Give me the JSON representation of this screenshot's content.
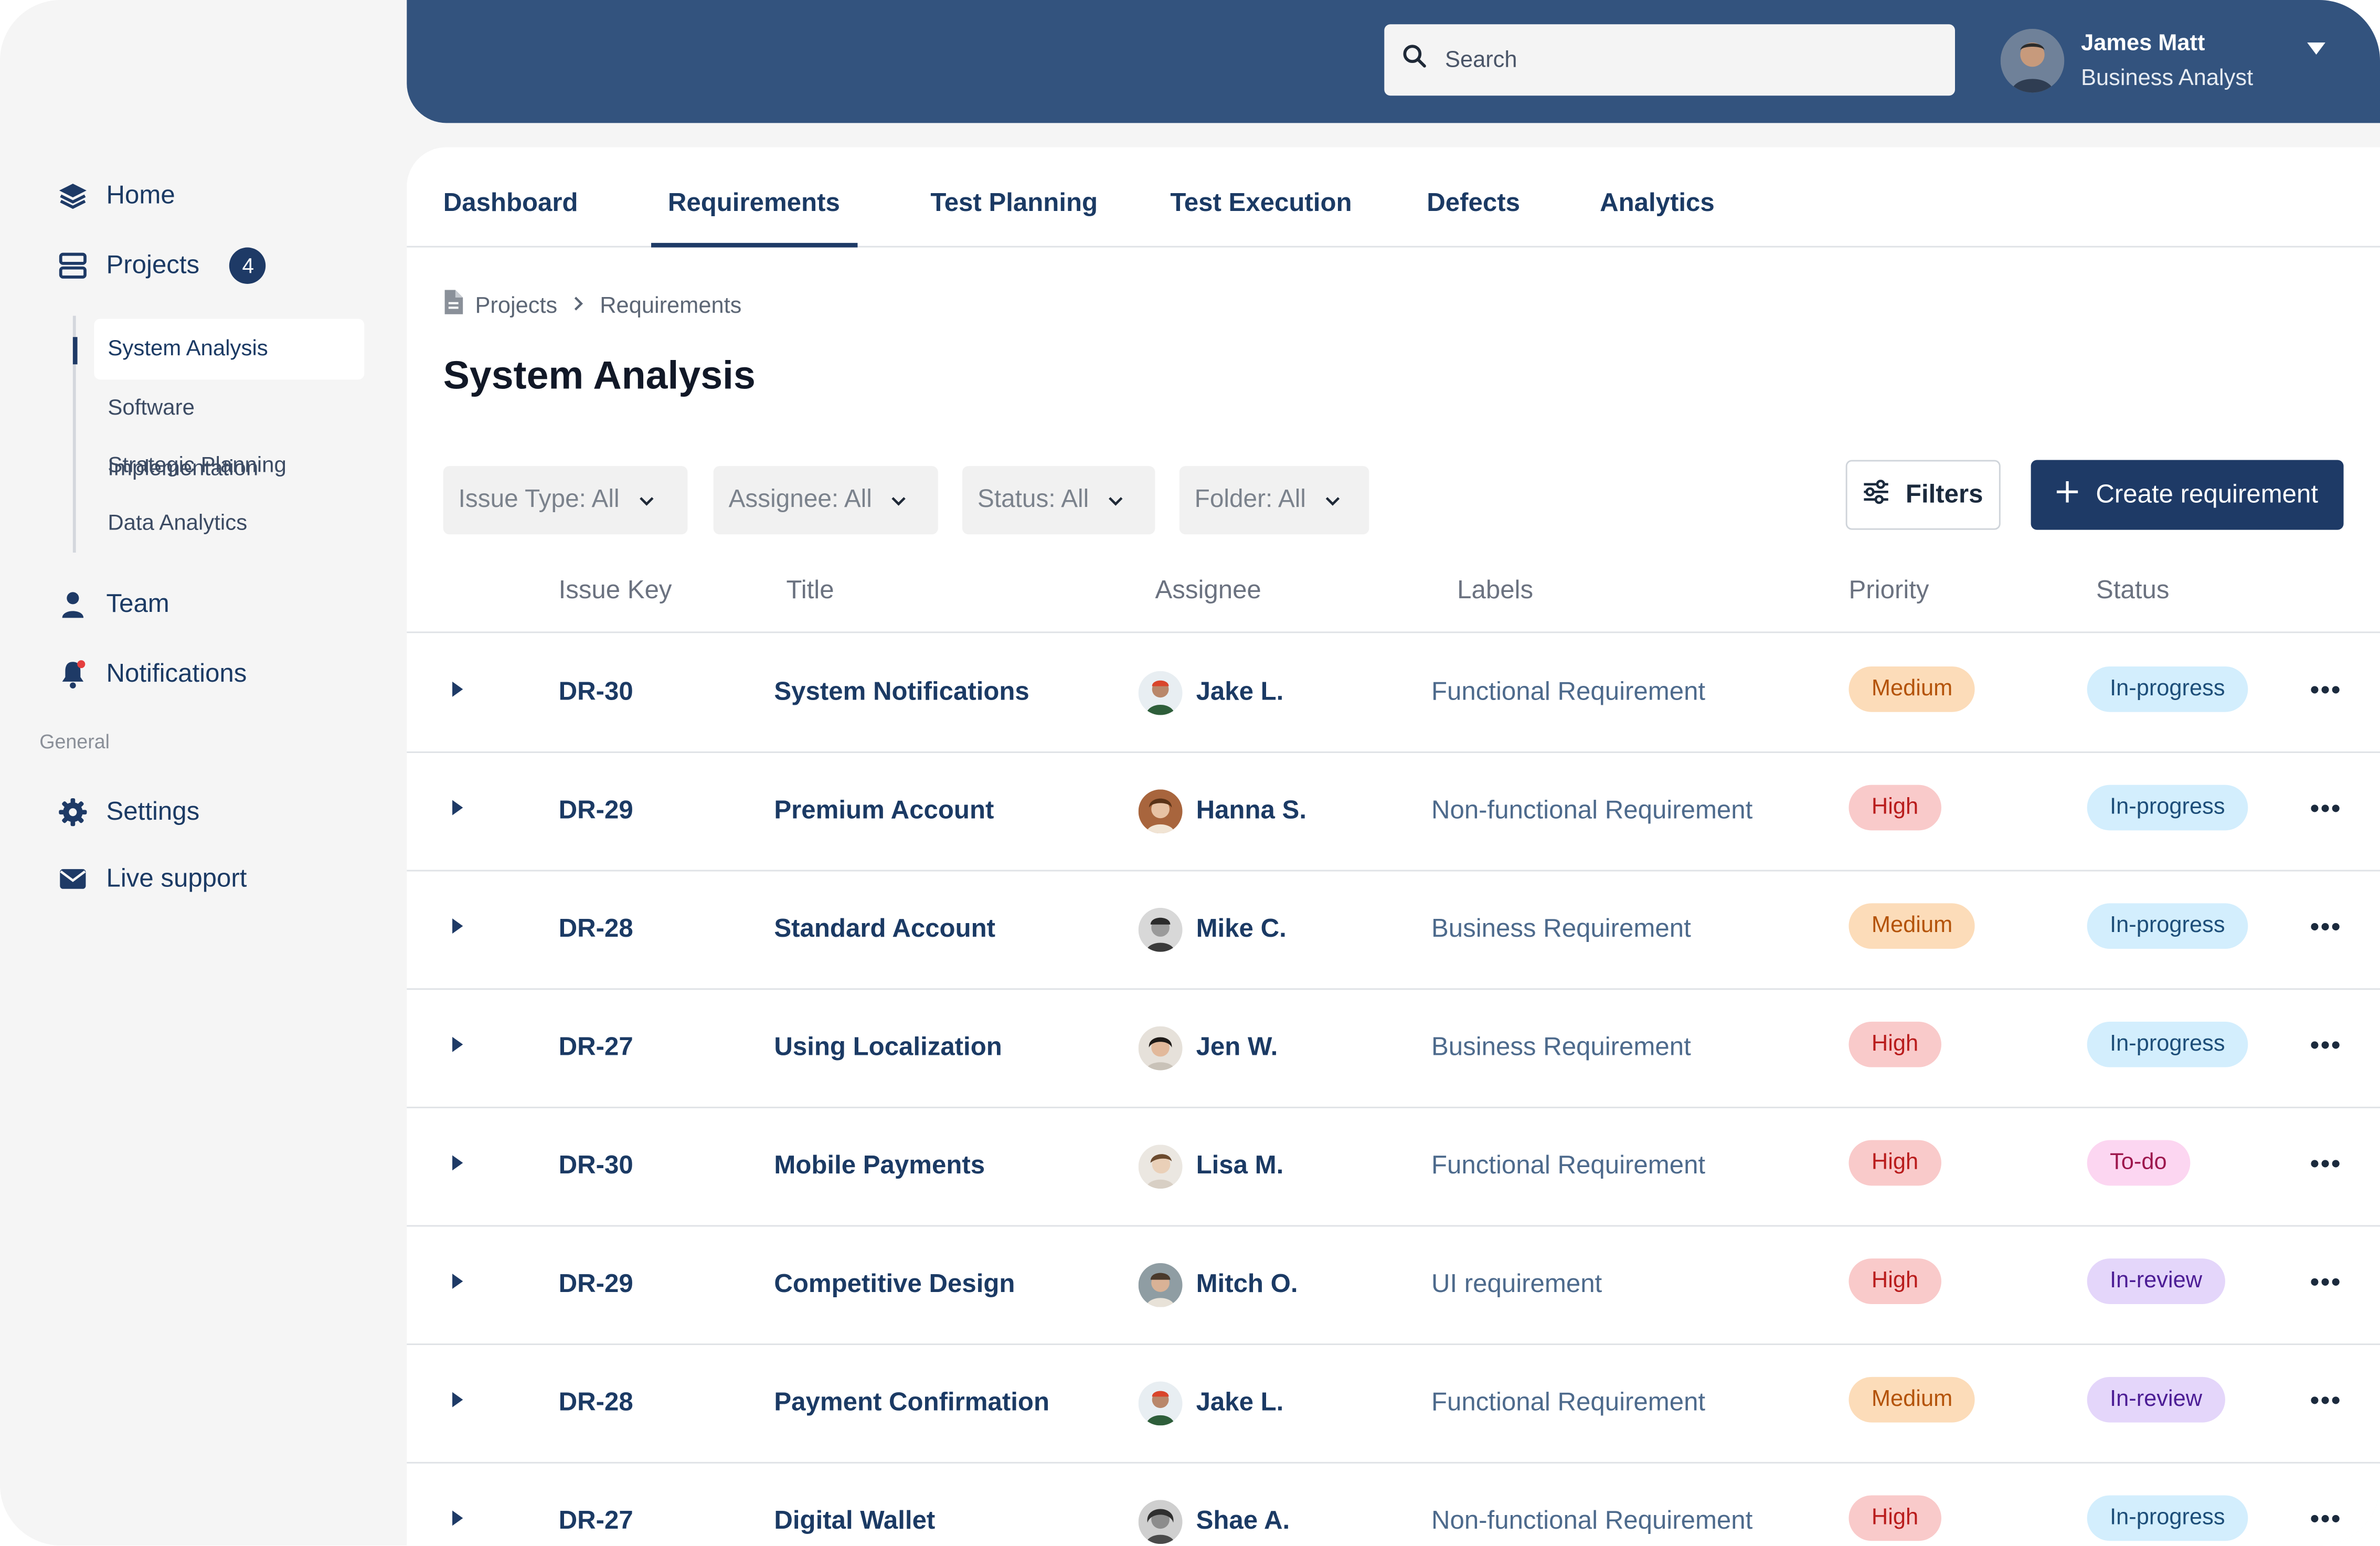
{
  "sidebar": {
    "home": "Home",
    "projects": "Projects",
    "projects_count": "4",
    "projects_sub": [
      "System Analysis",
      "Software Implementation",
      "Strategic Planning",
      "Data Analytics"
    ],
    "team": "Team",
    "notifications": "Notifications",
    "section_general": "General",
    "settings": "Settings",
    "live_support": "Live support"
  },
  "header": {
    "search_placeholder": "Search",
    "user_name": "James Matt",
    "user_role": "Business Analyst"
  },
  "tabs": [
    "Dashboard",
    "Requirements",
    "Test Planning",
    "Test Execution",
    "Defects",
    "Analytics"
  ],
  "active_tab": "Requirements",
  "breadcrumb": [
    "Projects",
    "Requirements"
  ],
  "page_title": "System Analysis",
  "filters": {
    "issue_type": "Issue Type: All",
    "assignee": "Assignee: All",
    "status": "Status: All",
    "folder": "Folder: All",
    "filters_button": "Filters",
    "create_button": "Create requirement"
  },
  "table": {
    "headers": [
      "Issue Key",
      "Title",
      "Assignee",
      "Labels",
      "Priority",
      "Status"
    ],
    "rows": [
      {
        "key": "DR-30",
        "title": "System Notifications",
        "assignee": "Jake L.",
        "label": "Functional Requirement",
        "priority": "Medium",
        "status": "In-progress"
      },
      {
        "key": "DR-29",
        "title": "Premium Account",
        "assignee": "Hanna S.",
        "label": "Non-functional Requirement",
        "priority": "High",
        "status": "In-progress"
      },
      {
        "key": "DR-28",
        "title": "Standard Account",
        "assignee": "Mike C.",
        "label": "Business Requirement",
        "priority": "Medium",
        "status": "In-progress"
      },
      {
        "key": "DR-27",
        "title": "Using Localization",
        "assignee": "Jen W.",
        "label": "Business Requirement",
        "priority": "High",
        "status": "In-progress"
      },
      {
        "key": "DR-30",
        "title": "Mobile Payments",
        "assignee": "Lisa M.",
        "label": "Functional Requirement",
        "priority": "High",
        "status": "To-do"
      },
      {
        "key": "DR-29",
        "title": "Competitive Design",
        "assignee": "Mitch O.",
        "label": "UI requirement",
        "priority": "High",
        "status": "In-review"
      },
      {
        "key": "DR-28",
        "title": "Payment Confirmation",
        "assignee": "Jake L.",
        "label": "Functional Requirement",
        "priority": "Medium",
        "status": "In-review"
      },
      {
        "key": "DR-27",
        "title": "Digital Wallet",
        "assignee": "Shae A.",
        "label": "Non-functional Requirement",
        "priority": "High",
        "status": "In-progress"
      }
    ]
  },
  "colors": {
    "header_bg": "#33537e",
    "accent": "#1e3a66",
    "priority_medium_bg": "#fcdcb9",
    "priority_high_bg": "#f9caca",
    "status_inprogress_bg": "#d3eefd",
    "status_todo_bg": "#fcd6f1",
    "status_inreview_bg": "#e4d6fa"
  }
}
